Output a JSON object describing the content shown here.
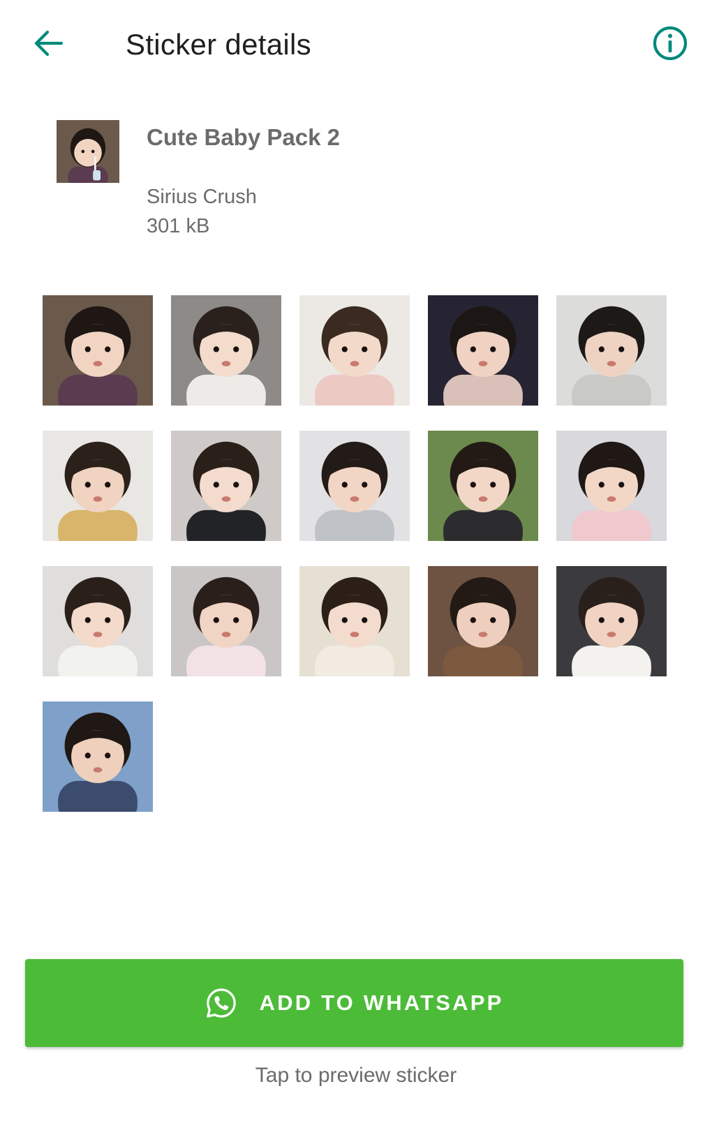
{
  "header": {
    "title": "Sticker details",
    "back_icon": "arrow-left-icon",
    "info_icon": "info-circle-icon",
    "accent": "#00897b"
  },
  "pack": {
    "name": "Cute Baby Pack 2",
    "author": "Sirius Crush",
    "size": "301 kB"
  },
  "stickers": [
    {
      "bg": "#6b5a4c",
      "hair": "#1e1714",
      "skin": "#f1d5c2",
      "shirt": "#5b3b4f"
    },
    {
      "bg": "#8d8a88",
      "hair": "#2a211c",
      "skin": "#f3dccc",
      "shirt": "#ecebe8"
    },
    {
      "bg": "#ece8e4",
      "hair": "#3a2a20",
      "skin": "#f2d9c9",
      "shirt": "#ecc9c3"
    },
    {
      "bg": "#262433",
      "hair": "#1c1614",
      "skin": "#f0d2c3",
      "shirt": "#d9c0b8"
    },
    {
      "bg": "#dcdcda",
      "hair": "#1d1916",
      "skin": "#eed3c3",
      "shirt": "#c9c9c6"
    },
    {
      "bg": "#e9e7e4",
      "hair": "#2b201a",
      "skin": "#f0d3c0",
      "shirt": "#d8b56a"
    },
    {
      "bg": "#cfcac7",
      "hair": "#2a1f19",
      "skin": "#f3dccd",
      "shirt": "#222326"
    },
    {
      "bg": "#e2e2e4",
      "hair": "#231b17",
      "skin": "#f2d6c5",
      "shirt": "#bfc3c7"
    },
    {
      "bg": "#6c8a4d",
      "hair": "#231a15",
      "skin": "#f2d7c6",
      "shirt": "#2c2c2e"
    },
    {
      "bg": "#d8d8dd",
      "hair": "#1f1814",
      "skin": "#f2d7c7",
      "shirt": "#f0c9cf"
    },
    {
      "bg": "#dfdedc",
      "hair": "#2b2019",
      "skin": "#f3dacb",
      "shirt": "#f2f2ef"
    },
    {
      "bg": "#c9c6c5",
      "hair": "#2a1f1a",
      "skin": "#f0d4c4",
      "shirt": "#f2e1e5"
    },
    {
      "bg": "#e6e0d3",
      "hair": "#2c1f18",
      "skin": "#f3dcce",
      "shirt": "#f1ebe2"
    },
    {
      "bg": "#6e5342",
      "hair": "#231a15",
      "skin": "#eecfbd",
      "shirt": "#7d5a3f"
    },
    {
      "bg": "#3b3a3e",
      "hair": "#2a201b",
      "skin": "#f1d3c3",
      "shirt": "#f3f2ee"
    },
    {
      "bg": "#7fa0c8",
      "hair": "#1f1814",
      "skin": "#efd0bd",
      "shirt": "#3c4c6e"
    }
  ],
  "add_button": {
    "label": "ADD TO WHATSAPP",
    "icon": "whatsapp-icon",
    "color": "#4cbb38"
  },
  "hint": "Tap to preview sticker"
}
